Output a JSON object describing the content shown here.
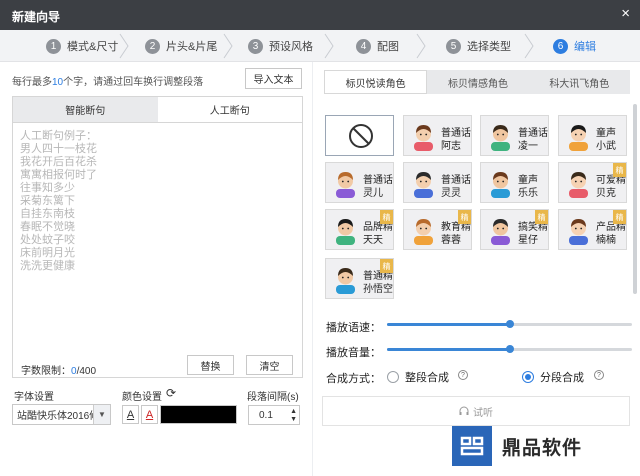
{
  "window": {
    "title": "新建向导",
    "close_icon": "×"
  },
  "steps": [
    {
      "num": "1",
      "label": "模式&尺寸"
    },
    {
      "num": "2",
      "label": "片头&片尾"
    },
    {
      "num": "3",
      "label": "预设风格"
    },
    {
      "num": "4",
      "label": "配图"
    },
    {
      "num": "5",
      "label": "选择类型"
    },
    {
      "num": "6",
      "label": "编辑"
    }
  ],
  "left": {
    "hint_prefix": "每行最多",
    "hint_count": "10",
    "hint_suffix": "个字，请通过回车换行调整段落",
    "import_button": "导入文本",
    "tabs": [
      "智能断句",
      "人工断句"
    ],
    "placeholder": "人工断句例子：\n男人四十一枝花\n我花开后百花杀\n寓寓相报何时了\n往事知多少\n采菊东篱下\n自挂东南枝\n春眠不觉晓\n处处蚊子咬\n床前明月光\n洗洗更健康",
    "word_limit_label": "字数限制：",
    "word_limit_current": "0",
    "word_limit_max": "/400",
    "replace_button": "替换",
    "clear_button": "清空",
    "font_label": "字体设置",
    "font_value": "站酷快乐体2016修",
    "color_label": "颜色设置",
    "color_refresh_icon": "⟳",
    "text_color": "#000000",
    "spacing_label": "段落间隔(s)",
    "spacing_value": "0.1"
  },
  "right": {
    "role_tabs": [
      "标贝悦读角色",
      "标贝情感角色",
      "科大讯飞角色"
    ],
    "voices": [
      {
        "l1": "",
        "l2": "",
        "none": true
      },
      {
        "l1": "普通话",
        "l2": "阿志"
      },
      {
        "l1": "普通话",
        "l2": "凌一"
      },
      {
        "l1": "童声",
        "l2": "小武"
      },
      {
        "l1": "普通话",
        "l2": "灵儿"
      },
      {
        "l1": "普通话",
        "l2": "灵灵"
      },
      {
        "l1": "童声",
        "l2": "乐乐"
      },
      {
        "l1": "可爱精",
        "l2": "贝克",
        "badge": "精"
      },
      {
        "l1": "品牌精",
        "l2": "天天",
        "badge": "精"
      },
      {
        "l1": "教育精",
        "l2": "蓉蓉",
        "badge": "精"
      },
      {
        "l1": "搞笑精",
        "l2": "星仔",
        "badge": "精"
      },
      {
        "l1": "产品精",
        "l2": "楠楠",
        "badge": "精"
      },
      {
        "l1": "普通精",
        "l2": "孙悟空",
        "badge": "精"
      }
    ],
    "speed_label": "播放语速：",
    "speed_level": 0.5,
    "volume_label": "播放音量：",
    "volume_level": 0.5,
    "mode_label": "合成方式：",
    "mode_options": [
      "整段合成",
      "分段合成"
    ],
    "mode_selected": 1,
    "listen_label": "试听",
    "listen_icon": "headphones-icon"
  },
  "watermark": {
    "text": "鼎品软件"
  },
  "colors": {
    "accent": "#2d7de0",
    "titlebar": "#3c3f44",
    "badge": "#e9b74a"
  }
}
